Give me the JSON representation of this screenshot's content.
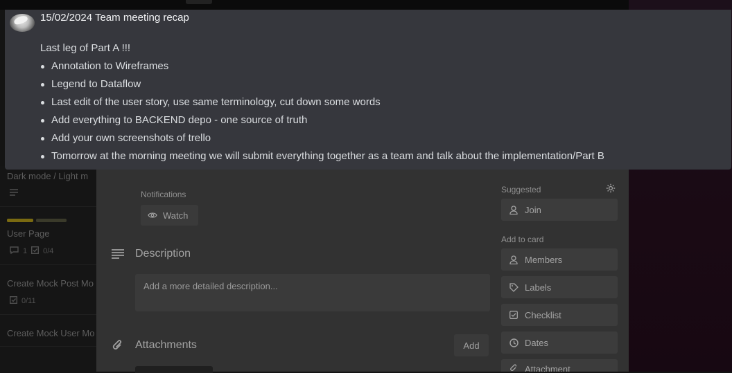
{
  "overlay": {
    "title": "15/02/2024 Team meeting recap",
    "lead": "Last leg of Part A !!!",
    "bullets": [
      "Annotation to Wireframes",
      "Legend to Dataflow",
      "Last edit of the user story, use same terminology, cut down some words",
      "Add everything to BACKEND depo - one source of truth",
      "Add your own screenshots of trello",
      "Tomorrow at the morning meeting we will submit everything together as a team and talk about the implementation/Part B"
    ]
  },
  "board": {
    "cards": [
      {
        "title": "Dark mode / Light m"
      },
      {
        "title": "User Page",
        "comments": "1",
        "checklist": "0/4"
      },
      {
        "title": "Create Mock Post Mo",
        "checklist": "0/11"
      },
      {
        "title": "Create Mock User Mo"
      }
    ]
  },
  "modal": {
    "notifications_label": "Notifications",
    "watch_label": "Watch",
    "description_title": "Description",
    "description_placeholder": "Add a more detailed description...",
    "attachments_title": "Attachments",
    "add_label": "Add",
    "sidebar": {
      "suggested_label": "Suggested",
      "join_label": "Join",
      "add_to_card_label": "Add to card",
      "members_label": "Members",
      "labels_label": "Labels",
      "checklist_label": "Checklist",
      "dates_label": "Dates",
      "attachment_label": "Attachment"
    }
  },
  "colors": {
    "overlay_bg": "#36373d",
    "label_yellow": "#7a6a11"
  },
  "icons": [
    "avatar",
    "description-icon",
    "attachment-icon",
    "eye-icon",
    "person-icon",
    "gear-icon",
    "label-icon",
    "checklist-icon",
    "clock-icon",
    "paperclip-icon",
    "comment-icon"
  ]
}
